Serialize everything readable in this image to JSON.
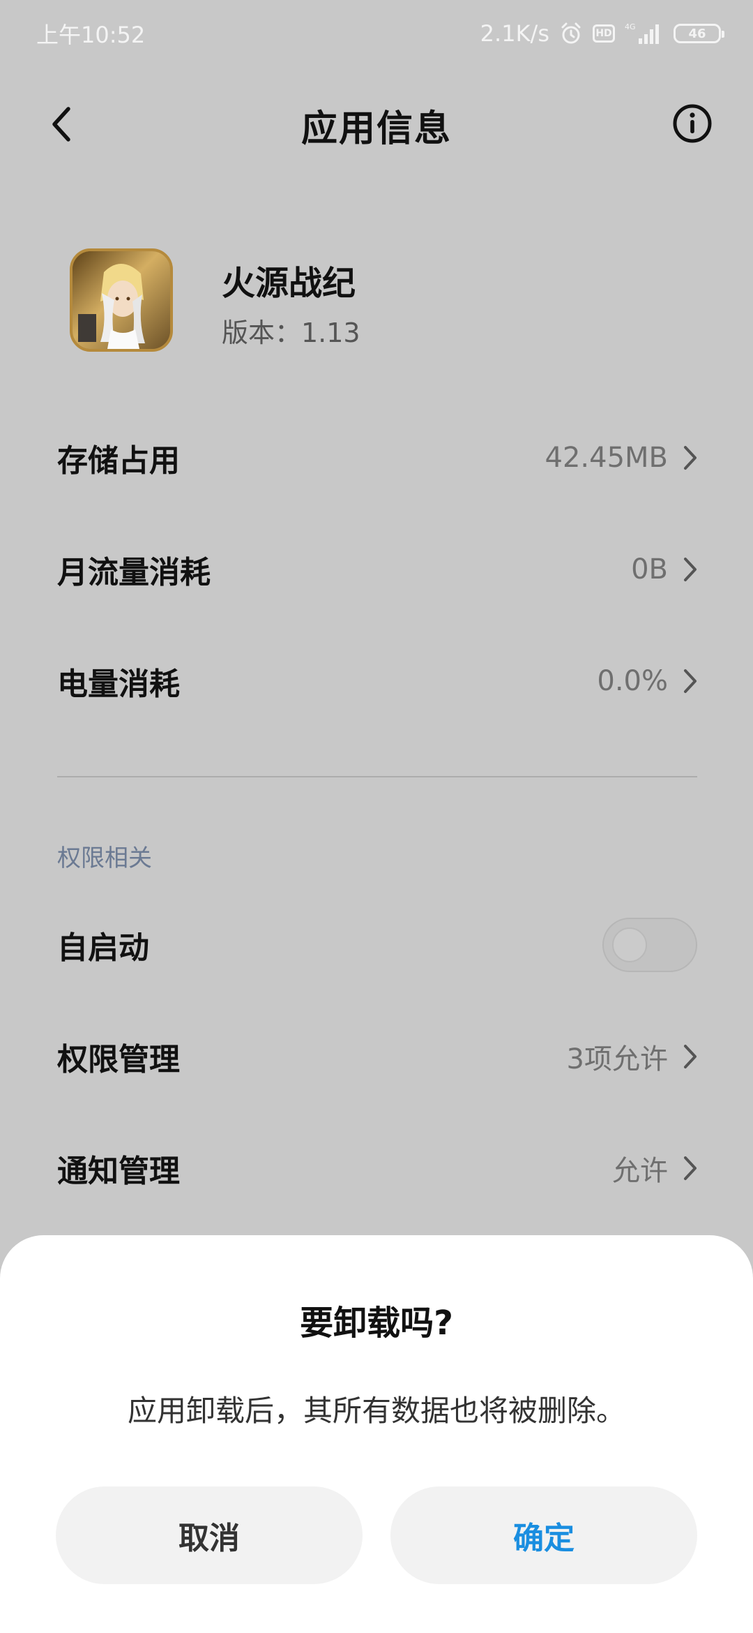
{
  "status_bar": {
    "time": "上午10:52",
    "speed": "2.1K/s",
    "hd": "HD",
    "network": "4G",
    "battery": "46"
  },
  "header": {
    "title": "应用信息"
  },
  "app": {
    "name": "火源战纪",
    "version": "版本：1.13"
  },
  "rows": [
    {
      "label": "存储占用",
      "value": "42.45MB"
    },
    {
      "label": "月流量消耗",
      "value": "0B"
    },
    {
      "label": "电量消耗",
      "value": "0.0%"
    }
  ],
  "permissions_section": {
    "header": "权限相关",
    "autostart": {
      "label": "自启动",
      "enabled": false
    },
    "rows": [
      {
        "label": "权限管理",
        "value": "3项允许"
      },
      {
        "label": "通知管理",
        "value": "允许"
      }
    ]
  },
  "dialog": {
    "title": "要卸载吗?",
    "message": "应用卸载后，其所有数据也将被删除。",
    "cancel": "取消",
    "confirm": "确定"
  },
  "colors": {
    "background": "#c8c8c8",
    "accent": "#1a8ee0",
    "section_header": "#6b7a93"
  }
}
